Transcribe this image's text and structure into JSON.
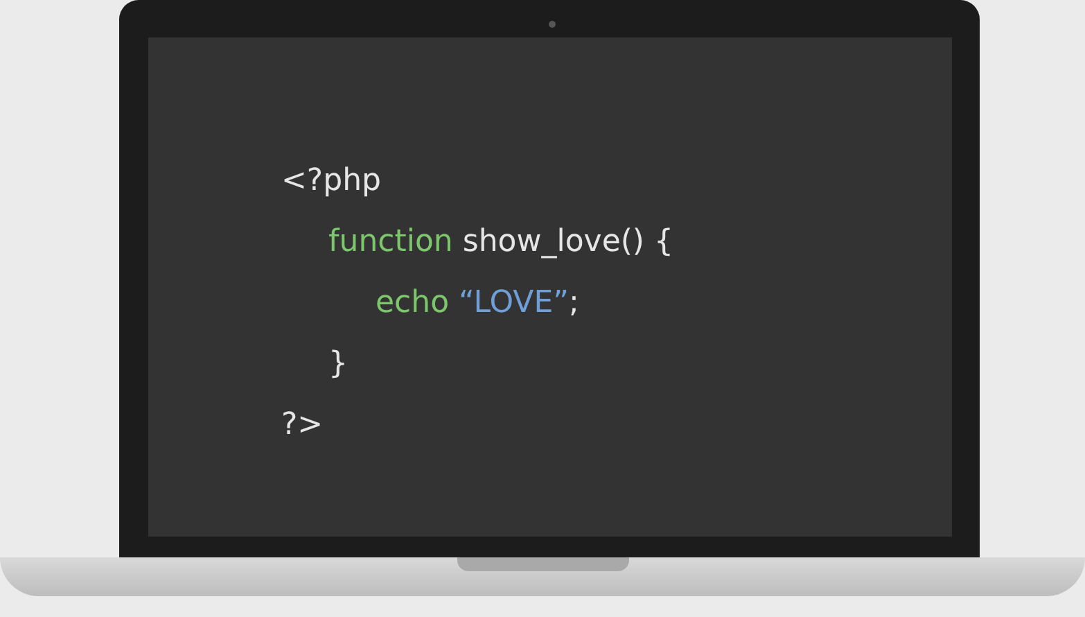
{
  "code": [
    {
      "tokens": [
        {
          "text": "<?php",
          "kind": "plain"
        }
      ],
      "children": [
        {
          "tokens": [
            {
              "text": "function",
              "kind": "keyword"
            },
            {
              "text": " show_love() {",
              "kind": "plain"
            }
          ],
          "children": [
            {
              "tokens": [
                {
                  "text": "echo ",
                  "kind": "keyword"
                },
                {
                  "text": "“LOVE”",
                  "kind": "string"
                },
                {
                  "text": ";",
                  "kind": "plain"
                }
              ]
            }
          ]
        },
        {
          "tokens": [
            {
              "text": "}",
              "kind": "plain"
            }
          ]
        }
      ]
    },
    {
      "tokens": [
        {
          "text": "?>",
          "kind": "plain"
        }
      ]
    }
  ]
}
